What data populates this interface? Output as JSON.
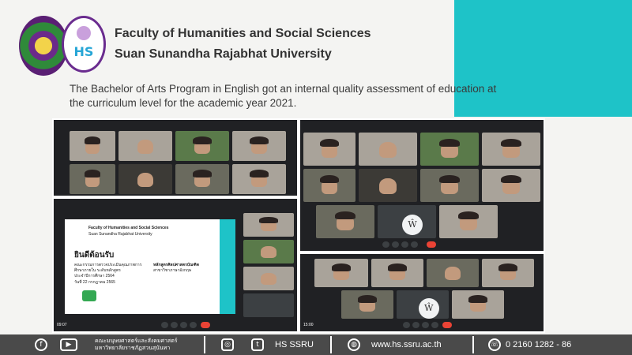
{
  "header": {
    "faculty": "Faculty of Humanities and Social Sciences",
    "university": "Suan Sunandha Rajabhat University",
    "headline": "The Bachelor of Arts Program in English got an internal quality assessment of education at the curriculum level for the academic year 2021."
  },
  "logos": {
    "hs_text": "HS"
  },
  "colors": {
    "accent": "#1ec3c8",
    "footer_bg": "#4a4a4a",
    "text_dark": "#333333"
  },
  "slide": {
    "faculty": "Faculty of Humanities and Social Sciences",
    "university": "Suan Sunandha Rajabhat University",
    "welcome": "ยินดีต้อนรับ",
    "line1": "คณะกรรมการตรวจประเมินคุณภาพการ",
    "line2": "ศึกษาภายใน ระดับหลักสูตร",
    "line3": "ประจำปีการศึกษา 2564",
    "date": "วันที่ 22 กรกฎาคม 2565",
    "program": "หลักสูตรศิลปศาสตรบัณฑิต",
    "major": "สาขาวิชาภาษาอังกฤษ"
  },
  "meet": {
    "time_a": "09:07",
    "time_b": "15:00",
    "avatar_letter": "Ŵ"
  },
  "footer": {
    "thai_line1": "คณะมนุษยศาสตร์และสังคมศาสตร์",
    "thai_line2": "มหาวิทยาลัยราชภัฏสวนสุนันทา",
    "social": "HS SSRU",
    "website": "www.hs.ssru.ac.th",
    "phone": "0 2160 1282 - 86",
    "icons": [
      "facebook-icon",
      "youtube-icon",
      "instagram-icon",
      "twitter-icon",
      "globe-icon",
      "phone-icon"
    ]
  }
}
